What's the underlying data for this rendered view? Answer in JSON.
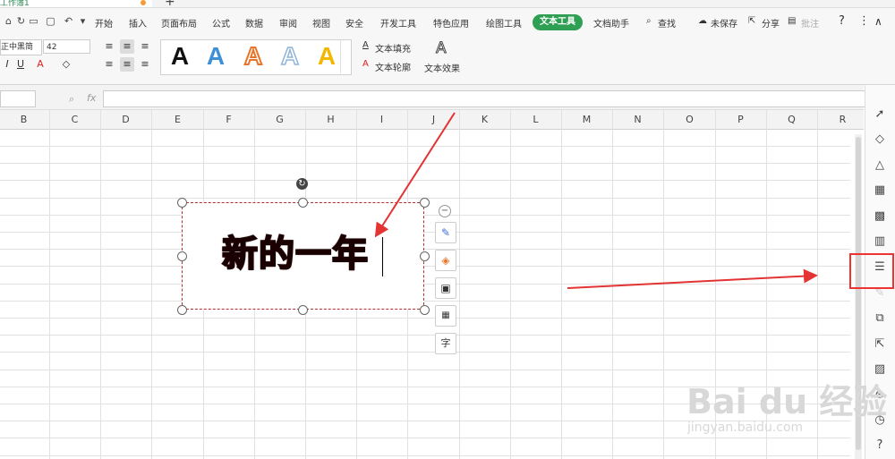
{
  "title_strip": {
    "doc_tab": "工作簿1",
    "new_tab": "+"
  },
  "menu": {
    "items": [
      "开始",
      "插入",
      "页面布局",
      "公式",
      "数据",
      "审阅",
      "视图",
      "安全",
      "开发工具",
      "特色应用",
      "绘图工具",
      "文本工具",
      "文档助手"
    ],
    "search": "查找",
    "save_status": "未保存",
    "share": "分享",
    "comment": "批注",
    "help": "?",
    "more": "⋮",
    "collapse": "∧"
  },
  "ribbon": {
    "font_name": "正中黑简",
    "font_size": "42",
    "gallery_letter": "A",
    "gallery_colors": [
      "#111111",
      "#3d8fd6",
      "#e8742a",
      "#8fb4d9",
      "#f2b800"
    ],
    "text_fill": "文本填充",
    "text_outline": "文本轮廓",
    "text_effect": "文本效果"
  },
  "formula_bar": {
    "fx": "fx"
  },
  "columns": [
    "B",
    "C",
    "D",
    "E",
    "F",
    "G",
    "H",
    "I",
    "J",
    "K",
    "L",
    "M",
    "N",
    "O",
    "P",
    "Q",
    "R"
  ],
  "textbox": {
    "content": "新的一年"
  },
  "colors": {
    "accent_green": "#2fa053",
    "annotation_red": "#e33333"
  },
  "watermark": {
    "logo": "Bai du 经验",
    "url": "jingyan.baidu.com"
  }
}
